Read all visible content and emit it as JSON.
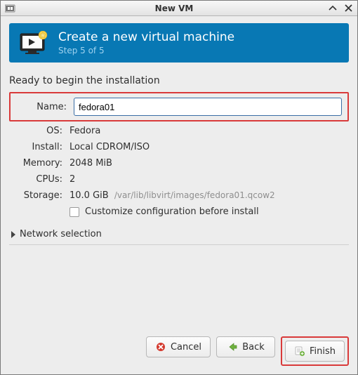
{
  "window": {
    "title": "New VM"
  },
  "banner": {
    "title": "Create a new virtual machine",
    "subtitle": "Step 5 of 5"
  },
  "ready_label": "Ready to begin the installation",
  "fields": {
    "name_label": "Name:",
    "name_value": "fedora01",
    "os_label": "OS:",
    "os_value": "Fedora",
    "install_label": "Install:",
    "install_value": "Local CDROM/ISO",
    "memory_label": "Memory:",
    "memory_value": "2048 MiB",
    "cpus_label": "CPUs:",
    "cpus_value": "2",
    "storage_label": "Storage:",
    "storage_value": "10.0 GiB",
    "storage_path": "/var/lib/libvirt/images/fedora01.qcow2"
  },
  "customize": {
    "label": "Customize configuration before install",
    "checked": false
  },
  "expander": {
    "label": "Network selection"
  },
  "buttons": {
    "cancel": "Cancel",
    "back": "Back",
    "finish": "Finish"
  }
}
